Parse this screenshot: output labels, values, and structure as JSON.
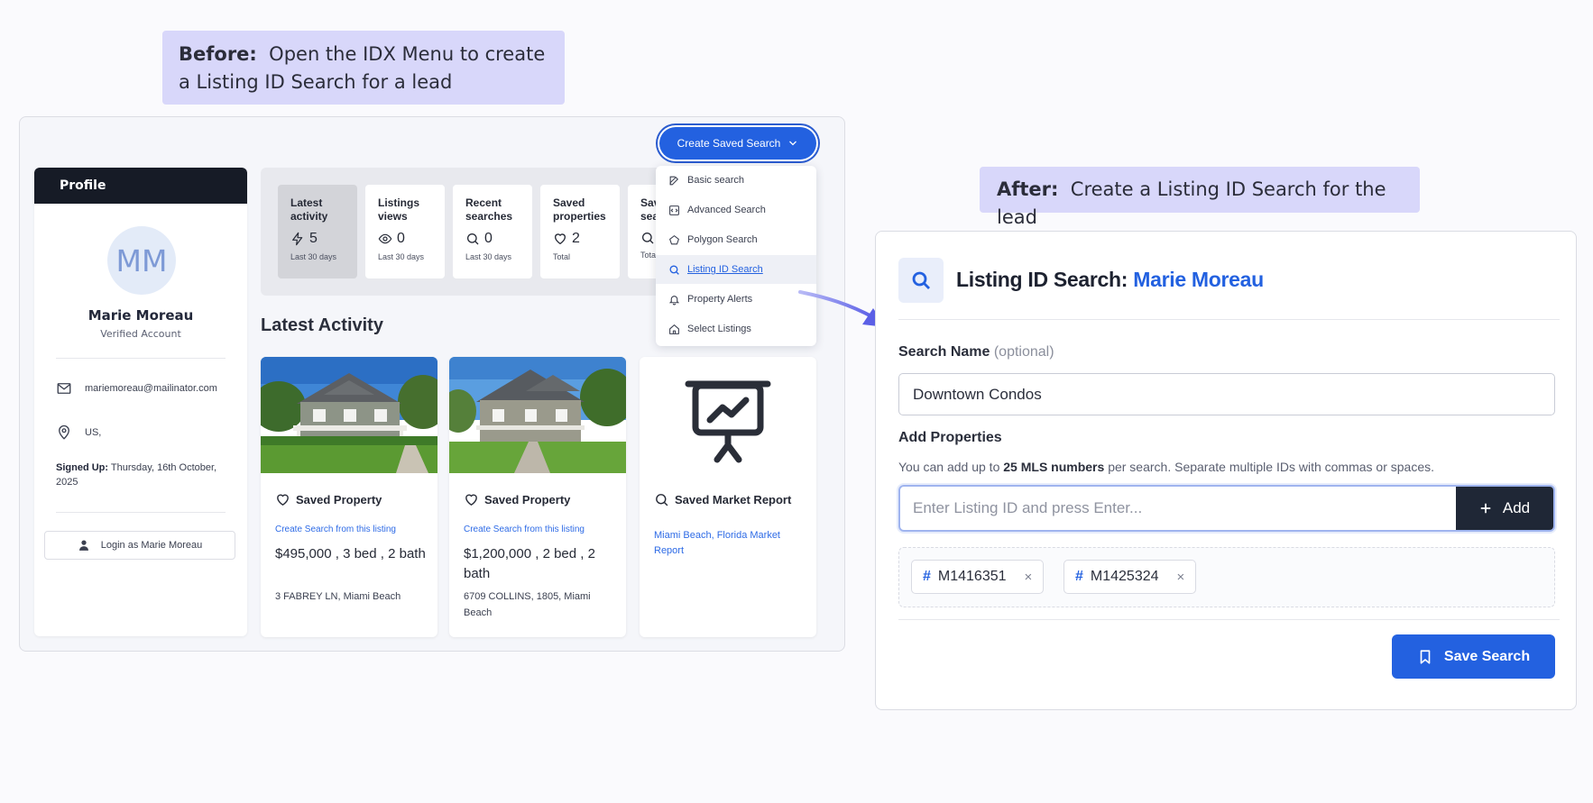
{
  "callouts": {
    "before_label": "Before:",
    "before_text": "Open the IDX Menu to create a Listing ID Search for a lead",
    "after_label": "After:",
    "after_text": "Create a Listing ID Search for the lead"
  },
  "menu": {
    "button_label": "Create Saved Search",
    "items": [
      {
        "label": "Basic search",
        "icon": "edit-icon"
      },
      {
        "label": "Advanced Search",
        "icon": "code-icon"
      },
      {
        "label": "Polygon Search",
        "icon": "pentagon-icon"
      },
      {
        "label": "Listing ID Search",
        "icon": "search-icon",
        "active": true
      },
      {
        "label": "Property Alerts",
        "icon": "bell-icon"
      },
      {
        "label": "Select Listings",
        "icon": "home-icon"
      }
    ]
  },
  "profile": {
    "header": "Profile",
    "initials": "MM",
    "name": "Marie Moreau",
    "status": "Verified Account",
    "email": "mariemoreau@mailinator.com",
    "location": "US,",
    "signed_up_label": "Signed Up:",
    "signed_up_value": "Thursday, 16th October, 2025",
    "login_button": "Login as Marie Moreau"
  },
  "stats": [
    {
      "label": "Latest activity",
      "value": "5",
      "note": "Last 30 days",
      "icon": "bolt-icon",
      "active": true
    },
    {
      "label": "Listings views",
      "value": "0",
      "note": "Last 30 days",
      "icon": "eye-icon"
    },
    {
      "label": "Recent searches",
      "value": "0",
      "note": "Last 30 days",
      "icon": "search-icon"
    },
    {
      "label": "Saved properties",
      "value": "2",
      "note": "Total",
      "icon": "heart-icon"
    },
    {
      "label": "Sav sea",
      "value": "",
      "note": "Tota",
      "icon": "search-icon"
    }
  ],
  "activity": {
    "title": "Latest Activity",
    "cards": [
      {
        "type": "Saved Property",
        "link": "Create Search from this listing",
        "price": "$495,000 , 3 bed , 2 bath",
        "address": "3 FABREY LN, Miami Beach"
      },
      {
        "type": "Saved Property",
        "link": "Create Search from this listing",
        "price": "$1,200,000 , 2 bed , 2 bath",
        "address": "6709 COLLINS, 1805, Miami Beach"
      },
      {
        "type": "Saved Market Report",
        "link": "Miami Beach, Florida Market Report"
      }
    ]
  },
  "after": {
    "title_prefix": "Listing ID Search:",
    "lead_name": "Marie Moreau",
    "search_name_label": "Search Name",
    "search_name_optional": "(optional)",
    "search_name_value": "Downtown Condos",
    "add_properties_label": "Add Properties",
    "hint_prefix": "You can add up to",
    "hint_bold": "25 MLS numbers",
    "hint_suffix": "per search. Separate multiple IDs with commas or spaces.",
    "id_placeholder": "Enter Listing ID and press Enter...",
    "add_button": "Add",
    "chips": [
      {
        "hash": "#",
        "id": "M1416351",
        "remove": "×"
      },
      {
        "hash": "#",
        "id": "M1425324",
        "remove": "×"
      }
    ],
    "save_button": "Save Search"
  },
  "colors": {
    "accent": "#2361e0",
    "callout_bg": "#d8d7fa",
    "dark": "#161b26",
    "arrow": "#6a6ee8"
  }
}
